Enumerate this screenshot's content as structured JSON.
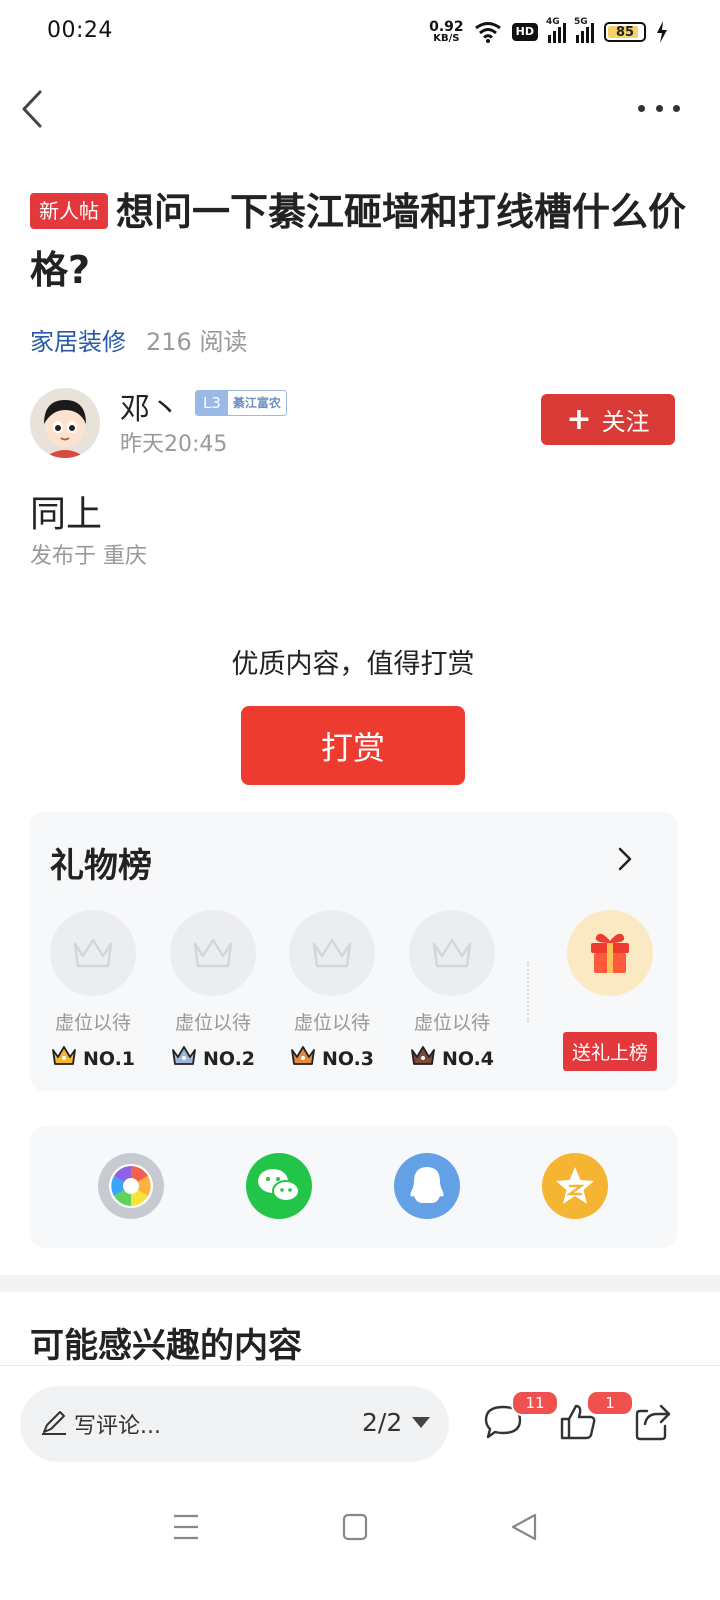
{
  "status_bar": {
    "time": "00:24",
    "net_speed_value": "0.92",
    "net_speed_unit": "KB/S",
    "hd_label": "HD",
    "signal1_label": "4G",
    "signal2_label": "5G",
    "battery": "85"
  },
  "post": {
    "tag": "新人帖",
    "title": "想问一下綦江砸墙和打线槽什么价格?",
    "category": "家居装修",
    "reads": "216 阅读",
    "author": {
      "name": "邓丶",
      "level": "L3",
      "level_title": "綦江富农",
      "time": "昨天20:45",
      "follow_label": "关注"
    },
    "content": "同上",
    "location": "发布于 重庆"
  },
  "reward": {
    "prompt": "优质内容，值得打赏",
    "button_label": "打赏"
  },
  "gift_board": {
    "title": "礼物榜",
    "slots": [
      {
        "status": "虚位以待",
        "rank": "NO.1",
        "crown_color": "#f2b731"
      },
      {
        "status": "虚位以待",
        "rank": "NO.2",
        "crown_color": "#9fb6d4"
      },
      {
        "status": "虚位以待",
        "rank": "NO.3",
        "crown_color": "#e88a3c"
      },
      {
        "status": "虚位以待",
        "rank": "NO.4",
        "crown_color": "#7a4a3a"
      }
    ],
    "send_button": "送礼上榜"
  },
  "share": {
    "icons": [
      "moments-icon",
      "wechat-icon",
      "qq-icon",
      "qzone-icon"
    ]
  },
  "interest_title": "可能感兴趣的内容",
  "bottom_bar": {
    "comment_placeholder": "写评论...",
    "page_indicator": "2/2",
    "comment_count": "11",
    "like_count": "1"
  },
  "colors": {
    "accent_red": "#e4393c",
    "link_blue": "#2a5ba6"
  }
}
